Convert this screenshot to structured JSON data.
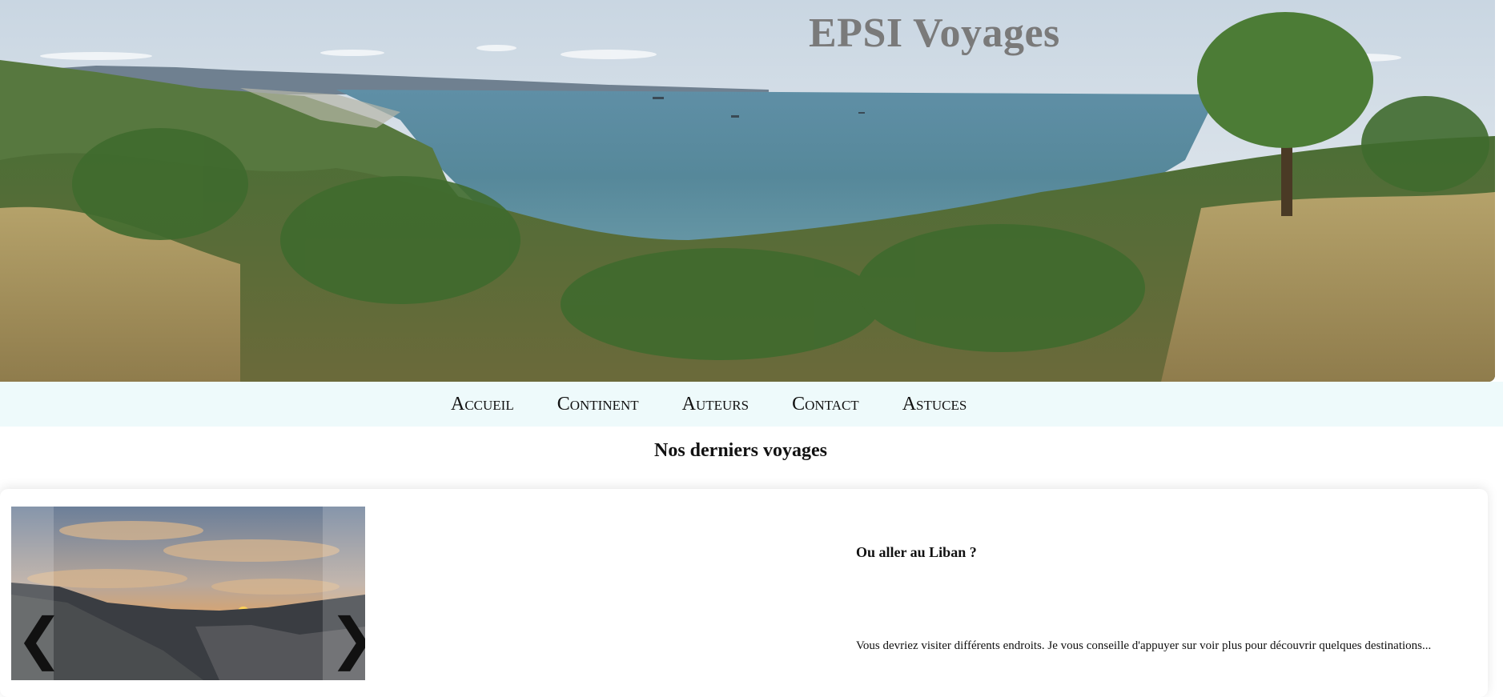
{
  "header": {
    "site_title": "EPSI Voyages"
  },
  "nav": {
    "items": [
      {
        "label": "Accueil"
      },
      {
        "label": "Continent"
      },
      {
        "label": "Auteurs"
      },
      {
        "label": "Contact"
      },
      {
        "label": "Astuces"
      }
    ]
  },
  "main": {
    "section_title": "Nos derniers voyages",
    "article": {
      "title": "Ou aller au Liban ?",
      "excerpt": "Vous devriez visiter différents endroits. Je vous conseille d'appuyer sur voir plus pour découvrir quelques destinations..."
    },
    "carousel": {
      "prev_icon": "chevron-left-icon",
      "next_icon": "chevron-right-icon",
      "prev_glyph": "❮",
      "next_glyph": "❯"
    }
  },
  "colors": {
    "nav_background": "#eefafb",
    "title_color": "#7a7a7a",
    "sea": "#4f7f94",
    "vegetation": "#4e7a3a"
  }
}
